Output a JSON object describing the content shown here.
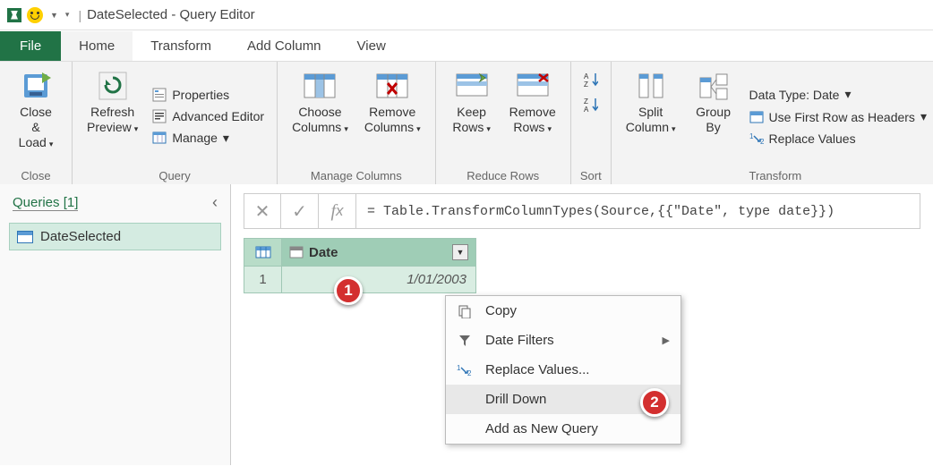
{
  "titlebar": {
    "title": "DateSelected - Query Editor"
  },
  "tabs": {
    "file": "File",
    "home": "Home",
    "transform": "Transform",
    "addcolumn": "Add Column",
    "view": "View"
  },
  "ribbon": {
    "close": {
      "closeLoad": "Close &\nLoad",
      "group": "Close"
    },
    "query": {
      "refresh": "Refresh\nPreview",
      "properties": "Properties",
      "advanced": "Advanced Editor",
      "manage": "Manage",
      "group": "Query"
    },
    "manageCols": {
      "choose": "Choose\nColumns",
      "remove": "Remove\nColumns",
      "group": "Manage Columns"
    },
    "reduce": {
      "keep": "Keep\nRows",
      "remove": "Remove\nRows",
      "group": "Reduce Rows"
    },
    "sort": {
      "group": "Sort"
    },
    "transform": {
      "split": "Split\nColumn",
      "groupby": "Group\nBy",
      "datatype": "Data Type: Date",
      "firstrow": "Use First Row as Headers",
      "replace": "Replace Values",
      "group": "Transform"
    }
  },
  "queries": {
    "header": "Queries [1]",
    "item": "DateSelected"
  },
  "formula": "= Table.TransformColumnTypes(Source,{{\"Date\", type date}})",
  "grid": {
    "col": "Date",
    "row": "1",
    "val": "1/01/2003"
  },
  "context": {
    "copy": "Copy",
    "filters": "Date Filters",
    "replace": "Replace Values...",
    "drill": "Drill Down",
    "addnew": "Add as New Query"
  },
  "callouts": {
    "c1": "1",
    "c2": "2"
  }
}
